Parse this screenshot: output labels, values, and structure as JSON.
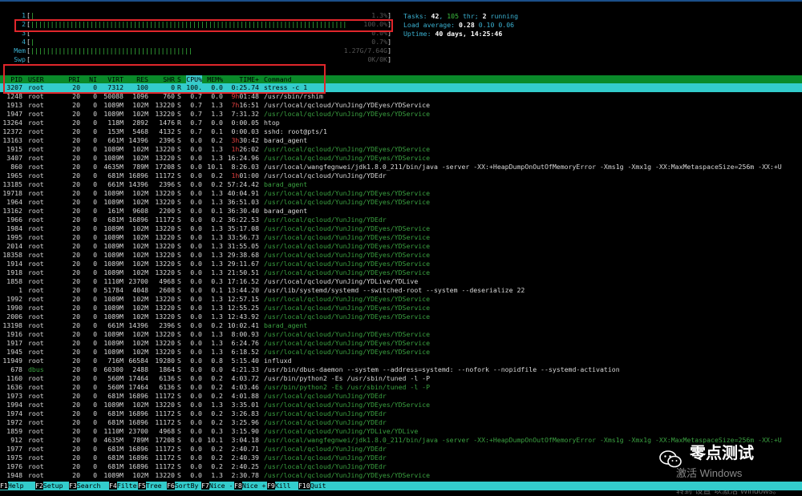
{
  "meters": [
    {
      "label": "1",
      "bar": "||",
      "value": "1.3%",
      "fill_ratio": 0.013
    },
    {
      "label": "2",
      "bar": "||||||||||||||||||||||||||||||||||||||||||||||||||||||||||||||||||||||||||||||||||||||||||||||||",
      "value": "100.0%",
      "fill_ratio": 1.0
    },
    {
      "label": "3",
      "bar": "",
      "value": "0.0%",
      "fill_ratio": 0.0
    },
    {
      "label": "4",
      "bar": "|",
      "value": "0.7%",
      "fill_ratio": 0.007
    },
    {
      "label": "Mem",
      "bar": "|||||||||||||||||||||||||||||||||||||||||||||||||||",
      "value": "1.27G/7.64G",
      "fill_ratio": 0.5
    },
    {
      "label": "Swp",
      "bar": "",
      "value": "0K/0K",
      "fill_ratio": 0.0
    }
  ],
  "summary": {
    "tasks_label": "Tasks:",
    "tasks": "42",
    "sep1": ",",
    "thr": "105",
    "thr_label": "thr;",
    "running": "2",
    "running_label": "running",
    "load_label": "Load average:",
    "load1": "0.28",
    "load5": "0.10",
    "load15": "0.06",
    "uptime_label": "Uptime:",
    "uptime": "40 days, 14:25:46"
  },
  "header": {
    "pid": "PID",
    "user": "USER",
    "pri": "PRI",
    "ni": "NI",
    "virt": "VIRT",
    "res": "RES",
    "shr": "SHR",
    "s": "S",
    "cpu": "CPU%",
    "mem": "MEM%",
    "time": "TIME+",
    "cmd": "Command"
  },
  "processes": [
    {
      "pid": "3207",
      "user": "root",
      "pri": "20",
      "ni": "0",
      "virt": "7312",
      "res": "100",
      "shr": "0",
      "s": "R",
      "cpu": "100.",
      "mem": "0.0",
      "time_h": "",
      "time": "0:25.74",
      "cmd": "stress -c 1",
      "thread": false
    },
    {
      "pid": "1248",
      "user": "root",
      "pri": "20",
      "ni": "0",
      "virt": "50088",
      "res": "1096",
      "shr": "760",
      "s": "S",
      "cpu": "0.7",
      "mem": "0.0",
      "time_h": "9h",
      "time": "01:48",
      "cmd": "/usr/sbin/rshim",
      "thread": false
    },
    {
      "pid": "1913",
      "user": "root",
      "pri": "20",
      "ni": "0",
      "virt": "1089M",
      "res": "102M",
      "shr": "13220",
      "s": "S",
      "cpu": "0.7",
      "mem": "1.3",
      "time_h": "7h",
      "time": "16:51",
      "cmd": "/usr/local/qcloud/YunJing/YDEyes/YDService",
      "thread": false
    },
    {
      "pid": "1947",
      "user": "root",
      "pri": "20",
      "ni": "0",
      "virt": "1089M",
      "res": "102M",
      "shr": "13220",
      "s": "S",
      "cpu": "0.7",
      "mem": "1.3",
      "time_h": "",
      "time": "7:31.32",
      "cmd": "/usr/local/qcloud/YunJing/YDEyes/YDService",
      "thread": true
    },
    {
      "pid": "13264",
      "user": "root",
      "pri": "20",
      "ni": "0",
      "virt": "118M",
      "res": "2892",
      "shr": "1476",
      "s": "R",
      "cpu": "0.7",
      "mem": "0.0",
      "time_h": "",
      "time": "0:00.05",
      "cmd": "htop",
      "thread": false
    },
    {
      "pid": "12372",
      "user": "root",
      "pri": "20",
      "ni": "0",
      "virt": "153M",
      "res": "5468",
      "shr": "4132",
      "s": "S",
      "cpu": "0.7",
      "mem": "0.1",
      "time_h": "",
      "time": "0:00.03",
      "cmd": "sshd: root@pts/1",
      "thread": false
    },
    {
      "pid": "13163",
      "user": "root",
      "pri": "20",
      "ni": "0",
      "virt": "661M",
      "res": "14396",
      "shr": "2396",
      "s": "S",
      "cpu": "0.0",
      "mem": "0.2",
      "time_h": "3h",
      "time": "30:42",
      "cmd": "barad_agent",
      "thread": false
    },
    {
      "pid": "1915",
      "user": "root",
      "pri": "20",
      "ni": "0",
      "virt": "1089M",
      "res": "102M",
      "shr": "13220",
      "s": "S",
      "cpu": "0.0",
      "mem": "1.3",
      "time_h": "1h",
      "time": "26:02",
      "cmd": "/usr/local/qcloud/YunJing/YDEyes/YDService",
      "thread": true
    },
    {
      "pid": "3407",
      "user": "root",
      "pri": "20",
      "ni": "0",
      "virt": "1089M",
      "res": "102M",
      "shr": "13220",
      "s": "S",
      "cpu": "0.0",
      "mem": "1.3",
      "time_h": "",
      "time": "16:24.96",
      "cmd": "/usr/local/qcloud/YunJing/YDEyes/YDService",
      "thread": true
    },
    {
      "pid": "860",
      "user": "root",
      "pri": "20",
      "ni": "0",
      "virt": "4635M",
      "res": "789M",
      "shr": "17208",
      "s": "S",
      "cpu": "0.0",
      "mem": "10.1",
      "time_h": "",
      "time": "8:26.03",
      "cmd": "/usr/local/wangfegnwei/jdk1.8.0_211/bin/java -server -XX:+HeapDumpOnOutOfMemoryError -Xms1g -Xmx1g -XX:MaxMetaspaceSize=256m -XX:+U",
      "thread": false
    },
    {
      "pid": "1965",
      "user": "root",
      "pri": "20",
      "ni": "0",
      "virt": "681M",
      "res": "16896",
      "shr": "11172",
      "s": "S",
      "cpu": "0.0",
      "mem": "0.2",
      "time_h": "1h",
      "time": "01:00",
      "cmd": "/usr/local/qcloud/YunJing/YDEdr",
      "thread": false
    },
    {
      "pid": "13185",
      "user": "root",
      "pri": "20",
      "ni": "0",
      "virt": "661M",
      "res": "14396",
      "shr": "2396",
      "s": "S",
      "cpu": "0.0",
      "mem": "0.2",
      "time_h": "",
      "time": "57:24.42",
      "cmd": "barad_agent",
      "thread": true
    },
    {
      "pid": "19718",
      "user": "root",
      "pri": "20",
      "ni": "0",
      "virt": "1089M",
      "res": "102M",
      "shr": "13220",
      "s": "S",
      "cpu": "0.0",
      "mem": "1.3",
      "time_h": "",
      "time": "40:04.91",
      "cmd": "/usr/local/qcloud/YunJing/YDEyes/YDService",
      "thread": true
    },
    {
      "pid": "1964",
      "user": "root",
      "pri": "20",
      "ni": "0",
      "virt": "1089M",
      "res": "102M",
      "shr": "13220",
      "s": "S",
      "cpu": "0.0",
      "mem": "1.3",
      "time_h": "",
      "time": "36:51.03",
      "cmd": "/usr/local/qcloud/YunJing/YDEyes/YDService",
      "thread": true
    },
    {
      "pid": "13162",
      "user": "root",
      "pri": "20",
      "ni": "0",
      "virt": "161M",
      "res": "9608",
      "shr": "2200",
      "s": "S",
      "cpu": "0.0",
      "mem": "0.1",
      "time_h": "",
      "time": "36:30.40",
      "cmd": "barad_agent",
      "thread": false
    },
    {
      "pid": "1966",
      "user": "root",
      "pri": "20",
      "ni": "0",
      "virt": "681M",
      "res": "16896",
      "shr": "11172",
      "s": "S",
      "cpu": "0.0",
      "mem": "0.2",
      "time_h": "",
      "time": "36:22.53",
      "cmd": "/usr/local/qcloud/YunJing/YDEdr",
      "thread": true
    },
    {
      "pid": "1984",
      "user": "root",
      "pri": "20",
      "ni": "0",
      "virt": "1089M",
      "res": "102M",
      "shr": "13220",
      "s": "S",
      "cpu": "0.0",
      "mem": "1.3",
      "time_h": "",
      "time": "35:17.08",
      "cmd": "/usr/local/qcloud/YunJing/YDEyes/YDService",
      "thread": true
    },
    {
      "pid": "1995",
      "user": "root",
      "pri": "20",
      "ni": "0",
      "virt": "1089M",
      "res": "102M",
      "shr": "13220",
      "s": "S",
      "cpu": "0.0",
      "mem": "1.3",
      "time_h": "",
      "time": "33:56.73",
      "cmd": "/usr/local/qcloud/YunJing/YDEyes/YDService",
      "thread": true
    },
    {
      "pid": "2014",
      "user": "root",
      "pri": "20",
      "ni": "0",
      "virt": "1089M",
      "res": "102M",
      "shr": "13220",
      "s": "S",
      "cpu": "0.0",
      "mem": "1.3",
      "time_h": "",
      "time": "31:55.05",
      "cmd": "/usr/local/qcloud/YunJing/YDEyes/YDService",
      "thread": true
    },
    {
      "pid": "18358",
      "user": "root",
      "pri": "20",
      "ni": "0",
      "virt": "1089M",
      "res": "102M",
      "shr": "13220",
      "s": "S",
      "cpu": "0.0",
      "mem": "1.3",
      "time_h": "",
      "time": "29:38.68",
      "cmd": "/usr/local/qcloud/YunJing/YDEyes/YDService",
      "thread": true
    },
    {
      "pid": "1914",
      "user": "root",
      "pri": "20",
      "ni": "0",
      "virt": "1089M",
      "res": "102M",
      "shr": "13220",
      "s": "S",
      "cpu": "0.0",
      "mem": "1.3",
      "time_h": "",
      "time": "29:11.67",
      "cmd": "/usr/local/qcloud/YunJing/YDEyes/YDService",
      "thread": true
    },
    {
      "pid": "1918",
      "user": "root",
      "pri": "20",
      "ni": "0",
      "virt": "1089M",
      "res": "102M",
      "shr": "13220",
      "s": "S",
      "cpu": "0.0",
      "mem": "1.3",
      "time_h": "",
      "time": "21:50.51",
      "cmd": "/usr/local/qcloud/YunJing/YDEyes/YDService",
      "thread": true
    },
    {
      "pid": "1858",
      "user": "root",
      "pri": "20",
      "ni": "0",
      "virt": "1110M",
      "res": "23700",
      "shr": "4968",
      "s": "S",
      "cpu": "0.0",
      "mem": "0.3",
      "time_h": "",
      "time": "17:16.52",
      "cmd": "/usr/local/qcloud/YunJing/YDLive/YDLive",
      "thread": false
    },
    {
      "pid": "1",
      "user": "root",
      "pri": "20",
      "ni": "0",
      "virt": "51784",
      "res": "4048",
      "shr": "2608",
      "s": "S",
      "cpu": "0.0",
      "mem": "0.1",
      "time_h": "",
      "time": "13:44.20",
      "cmd": "/usr/lib/systemd/systemd --switched-root --system --deserialize 22",
      "thread": false
    },
    {
      "pid": "1992",
      "user": "root",
      "pri": "20",
      "ni": "0",
      "virt": "1089M",
      "res": "102M",
      "shr": "13220",
      "s": "S",
      "cpu": "0.0",
      "mem": "1.3",
      "time_h": "",
      "time": "12:57.15",
      "cmd": "/usr/local/qcloud/YunJing/YDEyes/YDService",
      "thread": true
    },
    {
      "pid": "1990",
      "user": "root",
      "pri": "20",
      "ni": "0",
      "virt": "1089M",
      "res": "102M",
      "shr": "13220",
      "s": "S",
      "cpu": "0.0",
      "mem": "1.3",
      "time_h": "",
      "time": "12:55.25",
      "cmd": "/usr/local/qcloud/YunJing/YDEyes/YDService",
      "thread": true
    },
    {
      "pid": "2006",
      "user": "root",
      "pri": "20",
      "ni": "0",
      "virt": "1089M",
      "res": "102M",
      "shr": "13220",
      "s": "S",
      "cpu": "0.0",
      "mem": "1.3",
      "time_h": "",
      "time": "12:43.92",
      "cmd": "/usr/local/qcloud/YunJing/YDEyes/YDService",
      "thread": true
    },
    {
      "pid": "13198",
      "user": "root",
      "pri": "20",
      "ni": "0",
      "virt": "661M",
      "res": "14396",
      "shr": "2396",
      "s": "S",
      "cpu": "0.0",
      "mem": "0.2",
      "time_h": "",
      "time": "10:02.41",
      "cmd": "barad_agent",
      "thread": true
    },
    {
      "pid": "1916",
      "user": "root",
      "pri": "20",
      "ni": "0",
      "virt": "1089M",
      "res": "102M",
      "shr": "13220",
      "s": "S",
      "cpu": "0.0",
      "mem": "1.3",
      "time_h": "",
      "time": "8:00.93",
      "cmd": "/usr/local/qcloud/YunJing/YDEyes/YDService",
      "thread": true
    },
    {
      "pid": "1917",
      "user": "root",
      "pri": "20",
      "ni": "0",
      "virt": "1089M",
      "res": "102M",
      "shr": "13220",
      "s": "S",
      "cpu": "0.0",
      "mem": "1.3",
      "time_h": "",
      "time": "6:24.76",
      "cmd": "/usr/local/qcloud/YunJing/YDEyes/YDService",
      "thread": true
    },
    {
      "pid": "1945",
      "user": "root",
      "pri": "20",
      "ni": "0",
      "virt": "1089M",
      "res": "102M",
      "shr": "13220",
      "s": "S",
      "cpu": "0.0",
      "mem": "1.3",
      "time_h": "",
      "time": "6:18.52",
      "cmd": "/usr/local/qcloud/YunJing/YDEyes/YDService",
      "thread": true
    },
    {
      "pid": "11949",
      "user": "root",
      "pri": "20",
      "ni": "0",
      "virt": "716M",
      "res": "66584",
      "shr": "19280",
      "s": "S",
      "cpu": "0.0",
      "mem": "0.8",
      "time_h": "",
      "time": "5:15.40",
      "cmd": "influxd",
      "thread": false
    },
    {
      "pid": "678",
      "user": "dbus",
      "pri": "20",
      "ni": "0",
      "virt": "60300",
      "res": "2488",
      "shr": "1864",
      "s": "S",
      "cpu": "0.0",
      "mem": "0.0",
      "time_h": "",
      "time": "4:21.33",
      "cmd": "/usr/bin/dbus-daemon --system --address=systemd: --nofork --nopidfile --systemd-activation",
      "thread": false,
      "user_dim": true
    },
    {
      "pid": "1160",
      "user": "root",
      "pri": "20",
      "ni": "0",
      "virt": "560M",
      "res": "17464",
      "shr": "6136",
      "s": "S",
      "cpu": "0.0",
      "mem": "0.2",
      "time_h": "",
      "time": "4:03.72",
      "cmd": "/usr/bin/python2 -Es /usr/sbin/tuned -l -P",
      "thread": false
    },
    {
      "pid": "1636",
      "user": "root",
      "pri": "20",
      "ni": "0",
      "virt": "560M",
      "res": "17464",
      "shr": "6136",
      "s": "S",
      "cpu": "0.0",
      "mem": "0.2",
      "time_h": "",
      "time": "4:03.46",
      "cmd": "/usr/bin/python2 -Es /usr/sbin/tuned -l -P",
      "thread": true
    },
    {
      "pid": "1973",
      "user": "root",
      "pri": "20",
      "ni": "0",
      "virt": "681M",
      "res": "16896",
      "shr": "11172",
      "s": "S",
      "cpu": "0.0",
      "mem": "0.2",
      "time_h": "",
      "time": "4:01.88",
      "cmd": "/usr/local/qcloud/YunJing/YDEdr",
      "thread": true
    },
    {
      "pid": "1994",
      "user": "root",
      "pri": "20",
      "ni": "0",
      "virt": "1089M",
      "res": "102M",
      "shr": "13220",
      "s": "S",
      "cpu": "0.0",
      "mem": "1.3",
      "time_h": "",
      "time": "3:35.01",
      "cmd": "/usr/local/qcloud/YunJing/YDEyes/YDService",
      "thread": true
    },
    {
      "pid": "1974",
      "user": "root",
      "pri": "20",
      "ni": "0",
      "virt": "681M",
      "res": "16896",
      "shr": "11172",
      "s": "S",
      "cpu": "0.0",
      "mem": "0.2",
      "time_h": "",
      "time": "3:26.83",
      "cmd": "/usr/local/qcloud/YunJing/YDEdr",
      "thread": true
    },
    {
      "pid": "1972",
      "user": "root",
      "pri": "20",
      "ni": "0",
      "virt": "681M",
      "res": "16896",
      "shr": "11172",
      "s": "S",
      "cpu": "0.0",
      "mem": "0.2",
      "time_h": "",
      "time": "3:25.96",
      "cmd": "/usr/local/qcloud/YunJing/YDEdr",
      "thread": true
    },
    {
      "pid": "1859",
      "user": "root",
      "pri": "20",
      "ni": "0",
      "virt": "1110M",
      "res": "23700",
      "shr": "4968",
      "s": "S",
      "cpu": "0.0",
      "mem": "0.3",
      "time_h": "",
      "time": "3:15.90",
      "cmd": "/usr/local/qcloud/YunJing/YDLive/YDLive",
      "thread": true
    },
    {
      "pid": "912",
      "user": "root",
      "pri": "20",
      "ni": "0",
      "virt": "4635M",
      "res": "789M",
      "shr": "17208",
      "s": "S",
      "cpu": "0.0",
      "mem": "10.1",
      "time_h": "",
      "time": "3:04.18",
      "cmd": "/usr/local/wangfegnwei/jdk1.8.0_211/bin/java -server -XX:+HeapDumpOnOutOfMemoryError -Xms1g -Xmx1g -XX:MaxMetaspaceSize=256m -XX:+U",
      "thread": true
    },
    {
      "pid": "1977",
      "user": "root",
      "pri": "20",
      "ni": "0",
      "virt": "681M",
      "res": "16896",
      "shr": "11172",
      "s": "S",
      "cpu": "0.0",
      "mem": "0.2",
      "time_h": "",
      "time": "2:40.71",
      "cmd": "/usr/local/qcloud/YunJing/YDEdr",
      "thread": true
    },
    {
      "pid": "1975",
      "user": "root",
      "pri": "20",
      "ni": "0",
      "virt": "681M",
      "res": "16896",
      "shr": "11172",
      "s": "S",
      "cpu": "0.0",
      "mem": "0.2",
      "time_h": "",
      "time": "2:40.39",
      "cmd": "/usr/local/qcloud/YunJing/YDEdr",
      "thread": true
    },
    {
      "pid": "1976",
      "user": "root",
      "pri": "20",
      "ni": "0",
      "virt": "681M",
      "res": "16896",
      "shr": "11172",
      "s": "S",
      "cpu": "0.0",
      "mem": "0.2",
      "time_h": "",
      "time": "2:40.25",
      "cmd": "/usr/local/qcloud/YunJing/YDEdr",
      "thread": true
    },
    {
      "pid": "1948",
      "user": "root",
      "pri": "20",
      "ni": "0",
      "virt": "1089M",
      "res": "102M",
      "shr": "13220",
      "s": "S",
      "cpu": "0.0",
      "mem": "1.3",
      "time_h": "",
      "time": "2:30.78",
      "cmd": "/usr/local/qcloud/YunJing/YDEyes/YDService",
      "thread": true
    }
  ],
  "footer": [
    {
      "key": "F1",
      "label": "Help"
    },
    {
      "key": "F2",
      "label": "Setup"
    },
    {
      "key": "F3",
      "label": "Search"
    },
    {
      "key": "F4",
      "label": "Filter"
    },
    {
      "key": "F5",
      "label": "Tree"
    },
    {
      "key": "F6",
      "label": "SortBy"
    },
    {
      "key": "F7",
      "label": "Nice -"
    },
    {
      "key": "F8",
      "label": "Nice +"
    },
    {
      "key": "F9",
      "label": "Kill"
    },
    {
      "key": "F10",
      "label": "Quit"
    }
  ],
  "watermark": {
    "text": "零点测试"
  },
  "activate": {
    "line1": "激活 Windows",
    "line2": "转到\"设置\"以激活 Windows。"
  },
  "colors": {
    "accent": "#33cccc",
    "header_bg": "#0a8a2a",
    "highlight": "#e0262b",
    "thread": "#3aa040"
  }
}
